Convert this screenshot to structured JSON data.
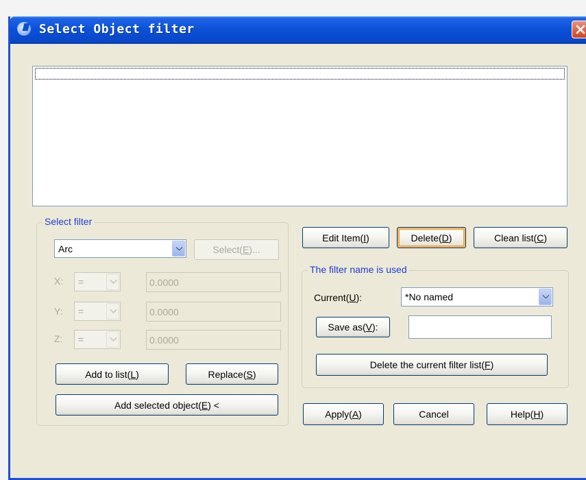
{
  "window": {
    "title": "Select Object filter"
  },
  "select_filter": {
    "legend": "Select filter",
    "object_type": "Arc",
    "select_button": {
      "text": "Select(",
      "key": "E",
      "suffix": ")..."
    },
    "x_label": "X:",
    "y_label": "Y:",
    "z_label": "Z:",
    "operator": "=",
    "x_value": "0.0000",
    "y_value": "0.0000",
    "z_value": "0.0000",
    "add_to_list": {
      "text": "Add to list(",
      "key": "L",
      "suffix": ")"
    },
    "replace": {
      "text": "Replace(",
      "key": "S",
      "suffix": ")"
    },
    "add_selected": {
      "text": "Add selected object(",
      "key": "E",
      "suffix": ") <"
    }
  },
  "list_buttons": {
    "edit_item": {
      "text": "Edit Item(",
      "key": "I",
      "suffix": ")"
    },
    "delete": {
      "text": "Delete(",
      "key": "D",
      "suffix": ")"
    },
    "clean_list": {
      "text": "Clean list(",
      "key": "C",
      "suffix": ")"
    }
  },
  "filter_name": {
    "legend": "The filter name is used",
    "current_label": {
      "text": "Current(",
      "key": "U",
      "suffix": "):"
    },
    "current_value": "*No named",
    "save_as": {
      "text": "Save as(",
      "key": "V",
      "suffix": "):"
    },
    "save_as_value": "",
    "delete_current": {
      "text": "Delete the current filter list(",
      "key": "F",
      "suffix": ")"
    }
  },
  "footer": {
    "apply": {
      "text": "Apply(",
      "key": "A",
      "suffix": ")"
    },
    "cancel": "Cancel",
    "help": {
      "text": "Help(",
      "key": "H",
      "suffix": ")"
    }
  },
  "colors": {
    "title_bar": "#0a50d8",
    "legend": "#1c3ed8",
    "dialog_bg": "#ece9d8",
    "close_button": "#d0451f"
  },
  "icons": {
    "app": "app-logo-icon",
    "close": "close-icon",
    "dropdown": "chevron-down-icon"
  }
}
